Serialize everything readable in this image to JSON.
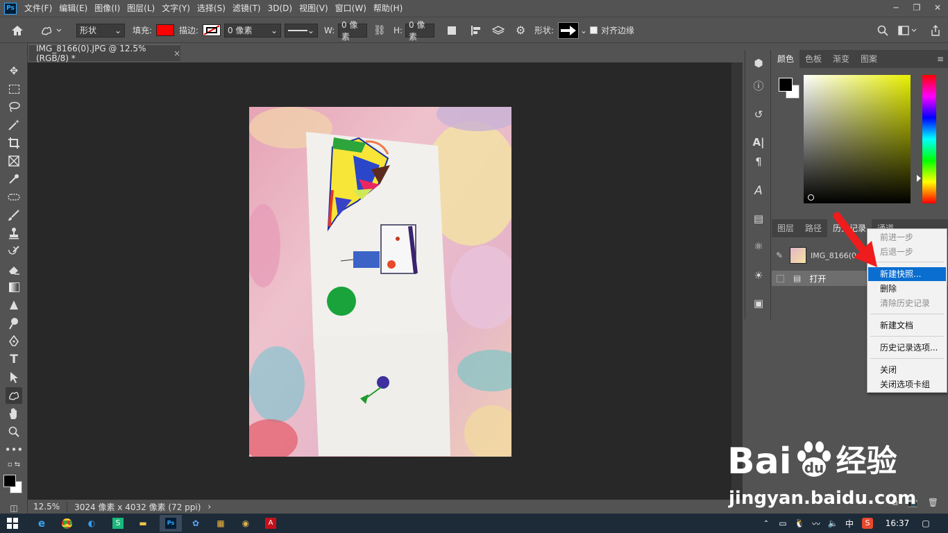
{
  "menubar": {
    "logo": "Ps",
    "items": [
      "文件(F)",
      "编辑(E)",
      "图像(I)",
      "图层(L)",
      "文字(Y)",
      "选择(S)",
      "滤镜(T)",
      "3D(D)",
      "视图(V)",
      "窗口(W)",
      "帮助(H)"
    ]
  },
  "options": {
    "mode": "形状",
    "fill_label": "填充:",
    "stroke_label": "描边:",
    "stroke_width": "0 像素",
    "w_label": "W:",
    "w_value": "0 像素",
    "h_label": "H:",
    "h_value": "0 像素",
    "shape_label": "形状:",
    "align_edges_label": "对齐边缘"
  },
  "document": {
    "tab_title": "IMG_8166(0).JPG @ 12.5%(RGB/8) *",
    "tab_close": "×"
  },
  "status": {
    "zoom": "12.5%",
    "info": "3024 像素 x 4032 像素 (72 ppi)",
    "arrow": "›"
  },
  "color_panel": {
    "tabs": [
      "颜色",
      "色板",
      "渐变",
      "图案"
    ],
    "active": 0
  },
  "history_panel": {
    "tabs": [
      "图层",
      "路径",
      "历史记录",
      "通道"
    ],
    "active": 2,
    "snapshot_name": "IMG_8166(0...",
    "steps": [
      "打开"
    ]
  },
  "context_menu": {
    "items": [
      {
        "label": "前进一步",
        "disabled": true
      },
      {
        "label": "后退一步",
        "disabled": true
      },
      {
        "label": "新建快照...",
        "highlighted": true
      },
      {
        "label": "删除"
      },
      {
        "label": "清除历史记录",
        "disabled": true
      },
      {
        "label": "新建文档"
      },
      {
        "label": "历史记录选项..."
      },
      {
        "label": "关闭"
      },
      {
        "label": "关闭选项卡组"
      }
    ]
  },
  "taskbar": {
    "time": "16:37",
    "ime": "中"
  },
  "watermark": {
    "brand": "Bai",
    "brand2": "经验",
    "url": "jingyan.baidu.com"
  },
  "colors": {
    "fill": "#ff0000",
    "accent": "#0a6ed1",
    "bg_dark": "#282828",
    "panel": "#535353"
  },
  "icons": [
    "home-icon",
    "custom-shape-tool-icon",
    "link-icon",
    "gear-icon",
    "search-icon",
    "workspace-icon",
    "share-icon",
    "move-tool-icon",
    "marquee-tool-icon",
    "lasso-tool-icon",
    "magic-wand-icon",
    "crop-tool-icon",
    "frame-tool-icon",
    "eyedropper-icon",
    "healing-brush-icon",
    "brush-tool-icon",
    "clone-stamp-icon",
    "history-brush-icon",
    "eraser-icon",
    "gradient-icon",
    "blur-tool-icon",
    "dodge-tool-icon",
    "pen-tool-icon",
    "type-tool-icon",
    "path-selection-icon",
    "hand-tool-icon",
    "zoom-tool-icon"
  ]
}
